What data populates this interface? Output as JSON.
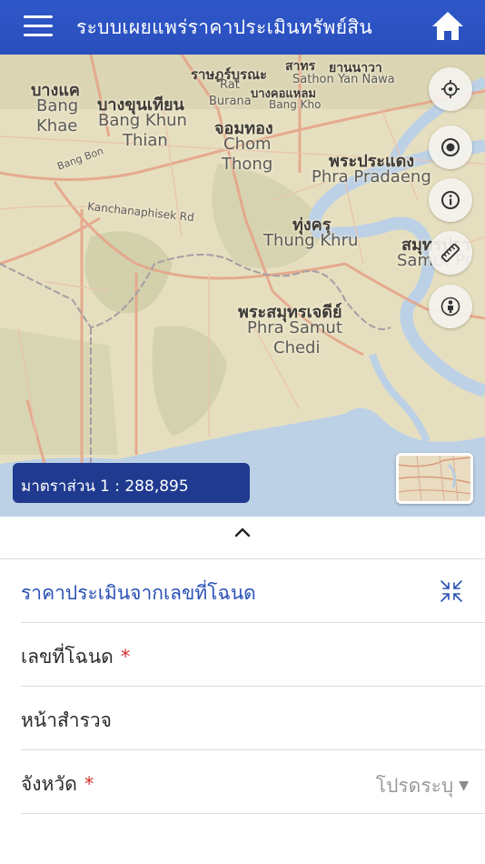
{
  "header": {
    "title": "ระบบเผยแพร่ราคาประเมินทรัพย์สิน",
    "menu_icon": "hamburger-menu-icon",
    "home_icon": "home-icon"
  },
  "map": {
    "labels": [
      {
        "id": "ratchaburana_th",
        "text": "ราษฎร์บูรณะ"
      },
      {
        "id": "ratchaburana_en",
        "text": "Rat"
      },
      {
        "id": "sathon_th",
        "text": "สาทร"
      },
      {
        "id": "yannawa_th",
        "text": "ยานนาวา"
      },
      {
        "id": "sathon_en",
        "text": "Sathon"
      },
      {
        "id": "yannawa_en",
        "text": "Yan Nawa"
      },
      {
        "id": "bangkholaem_th",
        "text": "บางคอแหลม"
      },
      {
        "id": "bangkho_en",
        "text": "Bang Kho"
      },
      {
        "id": "bangkhae_th",
        "text": "บางแค"
      },
      {
        "id": "bangkhae_en1",
        "text": "Bang"
      },
      {
        "id": "bangkhae_en2",
        "text": "Khae"
      },
      {
        "id": "bangkhunthian_th",
        "text": "บางขุนเทียน"
      },
      {
        "id": "bangkhunthian_en1",
        "text": "Bang Khun"
      },
      {
        "id": "bangkhunthian_en2",
        "text": "Thian"
      },
      {
        "id": "burana_en",
        "text": "Burana"
      },
      {
        "id": "chomthong_th",
        "text": "จอมทอง"
      },
      {
        "id": "chomthong_en1",
        "text": "Chom"
      },
      {
        "id": "chomthong_en2",
        "text": "Thong"
      },
      {
        "id": "phrapradaeng_th",
        "text": "พระประแดง"
      },
      {
        "id": "phrapradaeng_en",
        "text": "Phra Pradaeng"
      },
      {
        "id": "kanchana_en",
        "text": "Kanchanaphisek Rd"
      },
      {
        "id": "thungkhru_th",
        "text": "ทุ่งครุ"
      },
      {
        "id": "thungkhru_en",
        "text": "Thung Khru"
      },
      {
        "id": "samut_th",
        "text": "สมุทรปรา"
      },
      {
        "id": "samut_en",
        "text": "Samut Pr"
      },
      {
        "id": "phrasamut_th",
        "text": "พระสมุทรเจดีย์"
      },
      {
        "id": "phrasamut_en1",
        "text": "Phra Samut"
      },
      {
        "id": "phrasamut_en2",
        "text": "Chedi"
      },
      {
        "id": "bangbon_en",
        "text": "Bang Bon"
      }
    ],
    "tools": [
      "locate-me-icon",
      "target-icon",
      "info-icon",
      "ruler-icon",
      "person-location-icon"
    ],
    "scale_label": "มาตราส่วน",
    "scale_value": "1 : 288,895"
  },
  "panel": {
    "toggle_icon": "chevron-up-icon",
    "section_title": "ราคาประเมินจากเลขที่โฉนด",
    "collapse_icon": "collapse-arrows-icon",
    "fields": {
      "deed_number": {
        "label": "เลขที่โฉนด",
        "required": "*"
      },
      "survey_page": {
        "label": "หน้าสำรวจ"
      },
      "province": {
        "label": "จังหวัด",
        "required": "*",
        "value": "โปรดระบุ"
      }
    }
  },
  "colors": {
    "header_blue": "#2a4fbd",
    "scale_box": "#1f3a8f",
    "section_title": "#2950b5",
    "required": "#d32f2f",
    "sea": "#bcd1e6",
    "land": "#e6dfbf"
  }
}
